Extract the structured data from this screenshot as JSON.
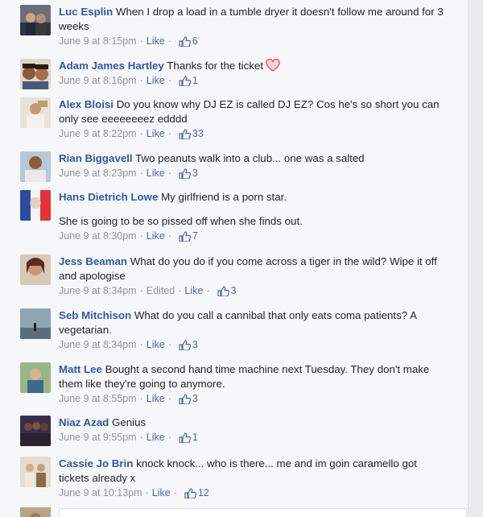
{
  "colors": {
    "author": "#365899",
    "meta": "#90949c",
    "like": "#4b67a1",
    "heart": "#f25268",
    "panel_bg": "#f6f7f9"
  },
  "comments": [
    {
      "author": "Luc Esplin",
      "text": "When I drop a load in a tumble dryer it doesn't follow me around for 3 weeks",
      "time": "June 9 at 8:15pm",
      "like_label": "Like",
      "likes": "6"
    },
    {
      "author": "Adam James Hartley",
      "text": "Thanks for the ticket",
      "emoji": "heart-icon",
      "time": "June 9 at 8:16pm",
      "like_label": "Like",
      "likes": "1"
    },
    {
      "author": "Alex Bloisi",
      "text": "Do you know why DJ EZ is called DJ EZ? Cos he's so short you can only see eeeeeeeez edddd",
      "time": "June 9 at 8:22pm",
      "like_label": "Like",
      "likes": "33"
    },
    {
      "author": "Rian Biggavell",
      "text": "Two peanuts walk into a club... one was a salted",
      "time": "June 9 at 8:23pm",
      "like_label": "Like",
      "likes": "3"
    },
    {
      "author": "Hans Dietrich Lowe",
      "text": "My girlfriend is a porn star.",
      "text2": "She is going to be so pissed off when she finds out.",
      "time": "June 9 at 8:30pm",
      "like_label": "Like",
      "likes": "7"
    },
    {
      "author": "Jess Beaman",
      "text": "What do you do if you come across a tiger in the wild? Wipe it off and apologise",
      "time": "June 9 at 8:34pm",
      "edited": "Edited",
      "like_label": "Like",
      "likes": "3"
    },
    {
      "author": "Seb Mitchison",
      "text": "What do you call a cannibal that only eats coma patients? A vegetarian.",
      "time": "June 9 at 8:34pm",
      "like_label": "Like",
      "likes": "3"
    },
    {
      "author": "Matt Lee",
      "text": "Bought a second hand time machine next Tuesday. They don't make them like they're going to anymore.",
      "time": "June 9 at 8:55pm",
      "like_label": "Like",
      "likes": "3"
    },
    {
      "author": "Niaz Azad",
      "text": "Genius",
      "time": "June 9 at 9:55pm",
      "like_label": "Like",
      "likes": "1"
    },
    {
      "author": "Cassie Jo Brin",
      "text": "knock knock... who is there... me and im goin caramello got tickets already x",
      "time": "June 9 at 10:13pm",
      "like_label": "Like",
      "likes": "12"
    }
  ]
}
